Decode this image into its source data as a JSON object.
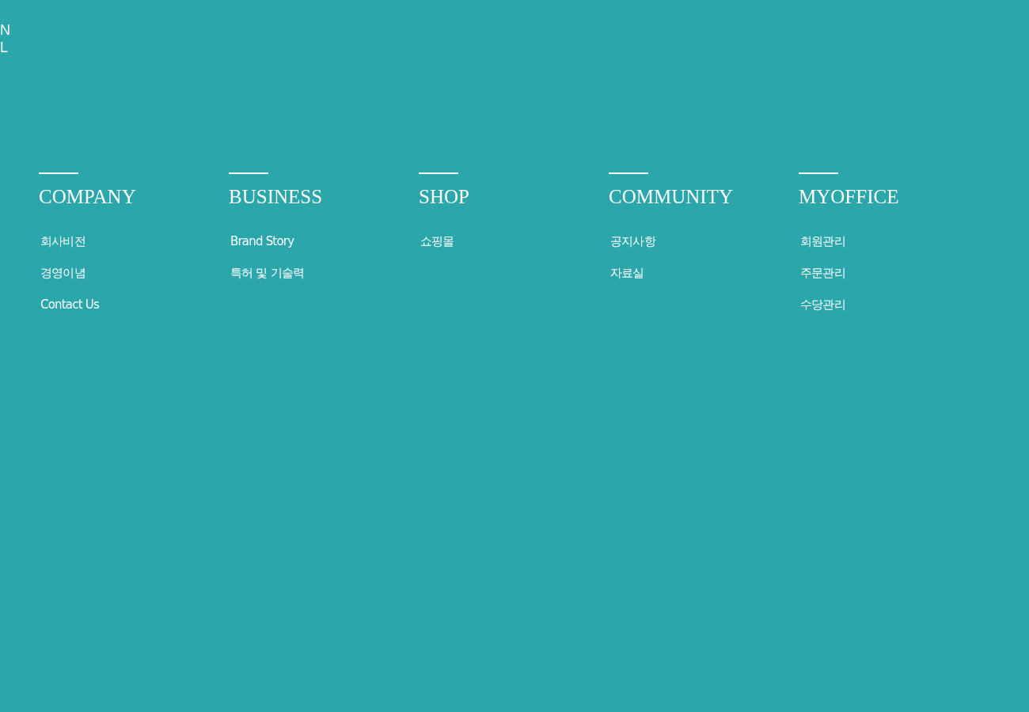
{
  "logo": {
    "lines": [
      "N",
      "L"
    ]
  },
  "menu_columns": [
    {
      "title": "COMPANY",
      "items": [
        "회사비전",
        "경영이념",
        "Contact Us"
      ]
    },
    {
      "title": "BUSINESS",
      "items": [
        "Brand Story",
        "특허 및 기술력"
      ]
    },
    {
      "title": "SHOP",
      "items": [
        "쇼핑몰"
      ]
    },
    {
      "title": "COMMUNITY",
      "items": [
        "공지사항",
        "자료실"
      ]
    },
    {
      "title": "MYOFFICE",
      "items": [
        "회원관리",
        "주문관리",
        "수당관리"
      ]
    }
  ]
}
